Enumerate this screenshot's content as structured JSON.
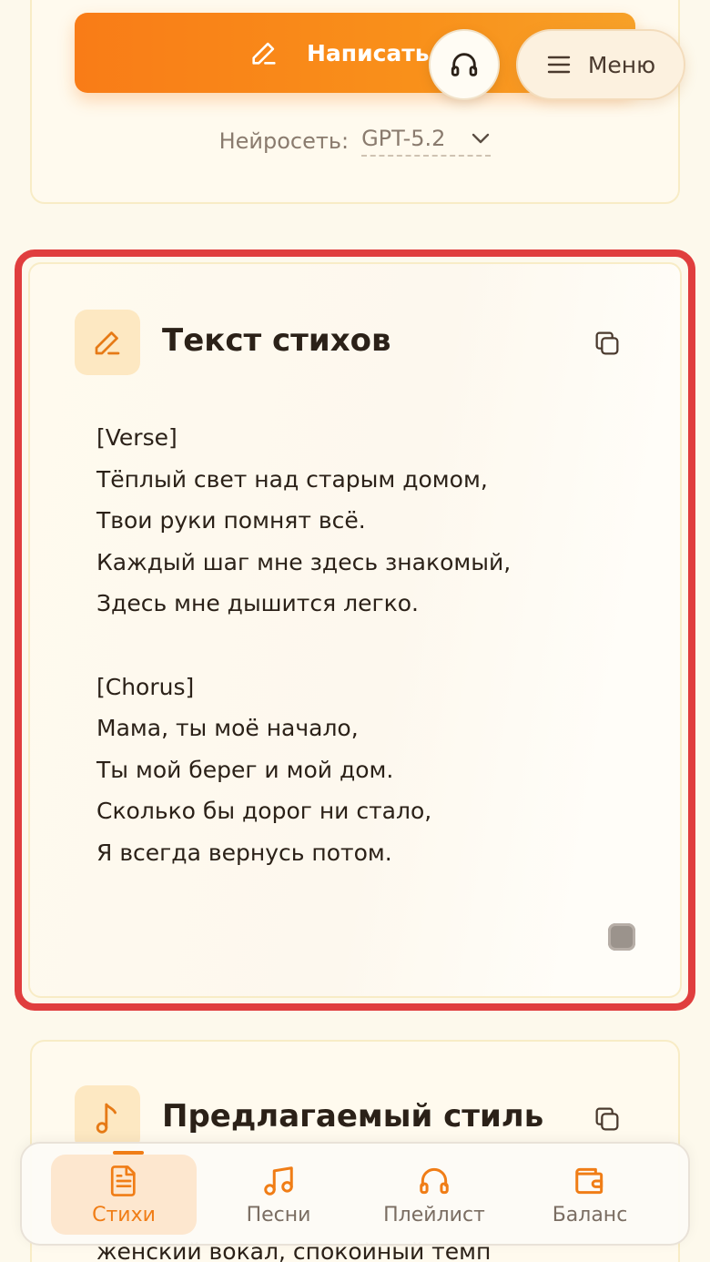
{
  "top": {
    "write_button_label": "Написать стихи",
    "menu_label": "Меню",
    "model_label": "Нейросеть:",
    "model_value": "GPT-5.2"
  },
  "lyrics_card": {
    "title": "Текст стихов",
    "lines": [
      "[Verse]",
      "Тёплый свет над старым домом,",
      "Твои руки помнят всё.",
      "Каждый шаг мне здесь знакомый,",
      "Здесь мне дышится легко.",
      "",
      "[Chorus]",
      "Мама, ты моё начало,",
      "Ты мой берег и мой дом.",
      "Сколько бы дорог ни стало,",
      "Я всегда вернусь потом."
    ]
  },
  "style_card": {
    "title": "Предлагаемый стиль",
    "peek_text": "женский вокал, спокойный темп"
  },
  "nav": {
    "items": [
      {
        "label": "Стихи",
        "icon": "document-icon",
        "active": true
      },
      {
        "label": "Песни",
        "icon": "music-notes-icon",
        "active": false
      },
      {
        "label": "Плейлист",
        "icon": "headphones-icon",
        "active": false
      },
      {
        "label": "Баланс",
        "icon": "wallet-icon",
        "active": false
      }
    ]
  },
  "colors": {
    "accent": "#f07d16",
    "highlight": "#e03e3e",
    "background": "#fdf9ec"
  }
}
